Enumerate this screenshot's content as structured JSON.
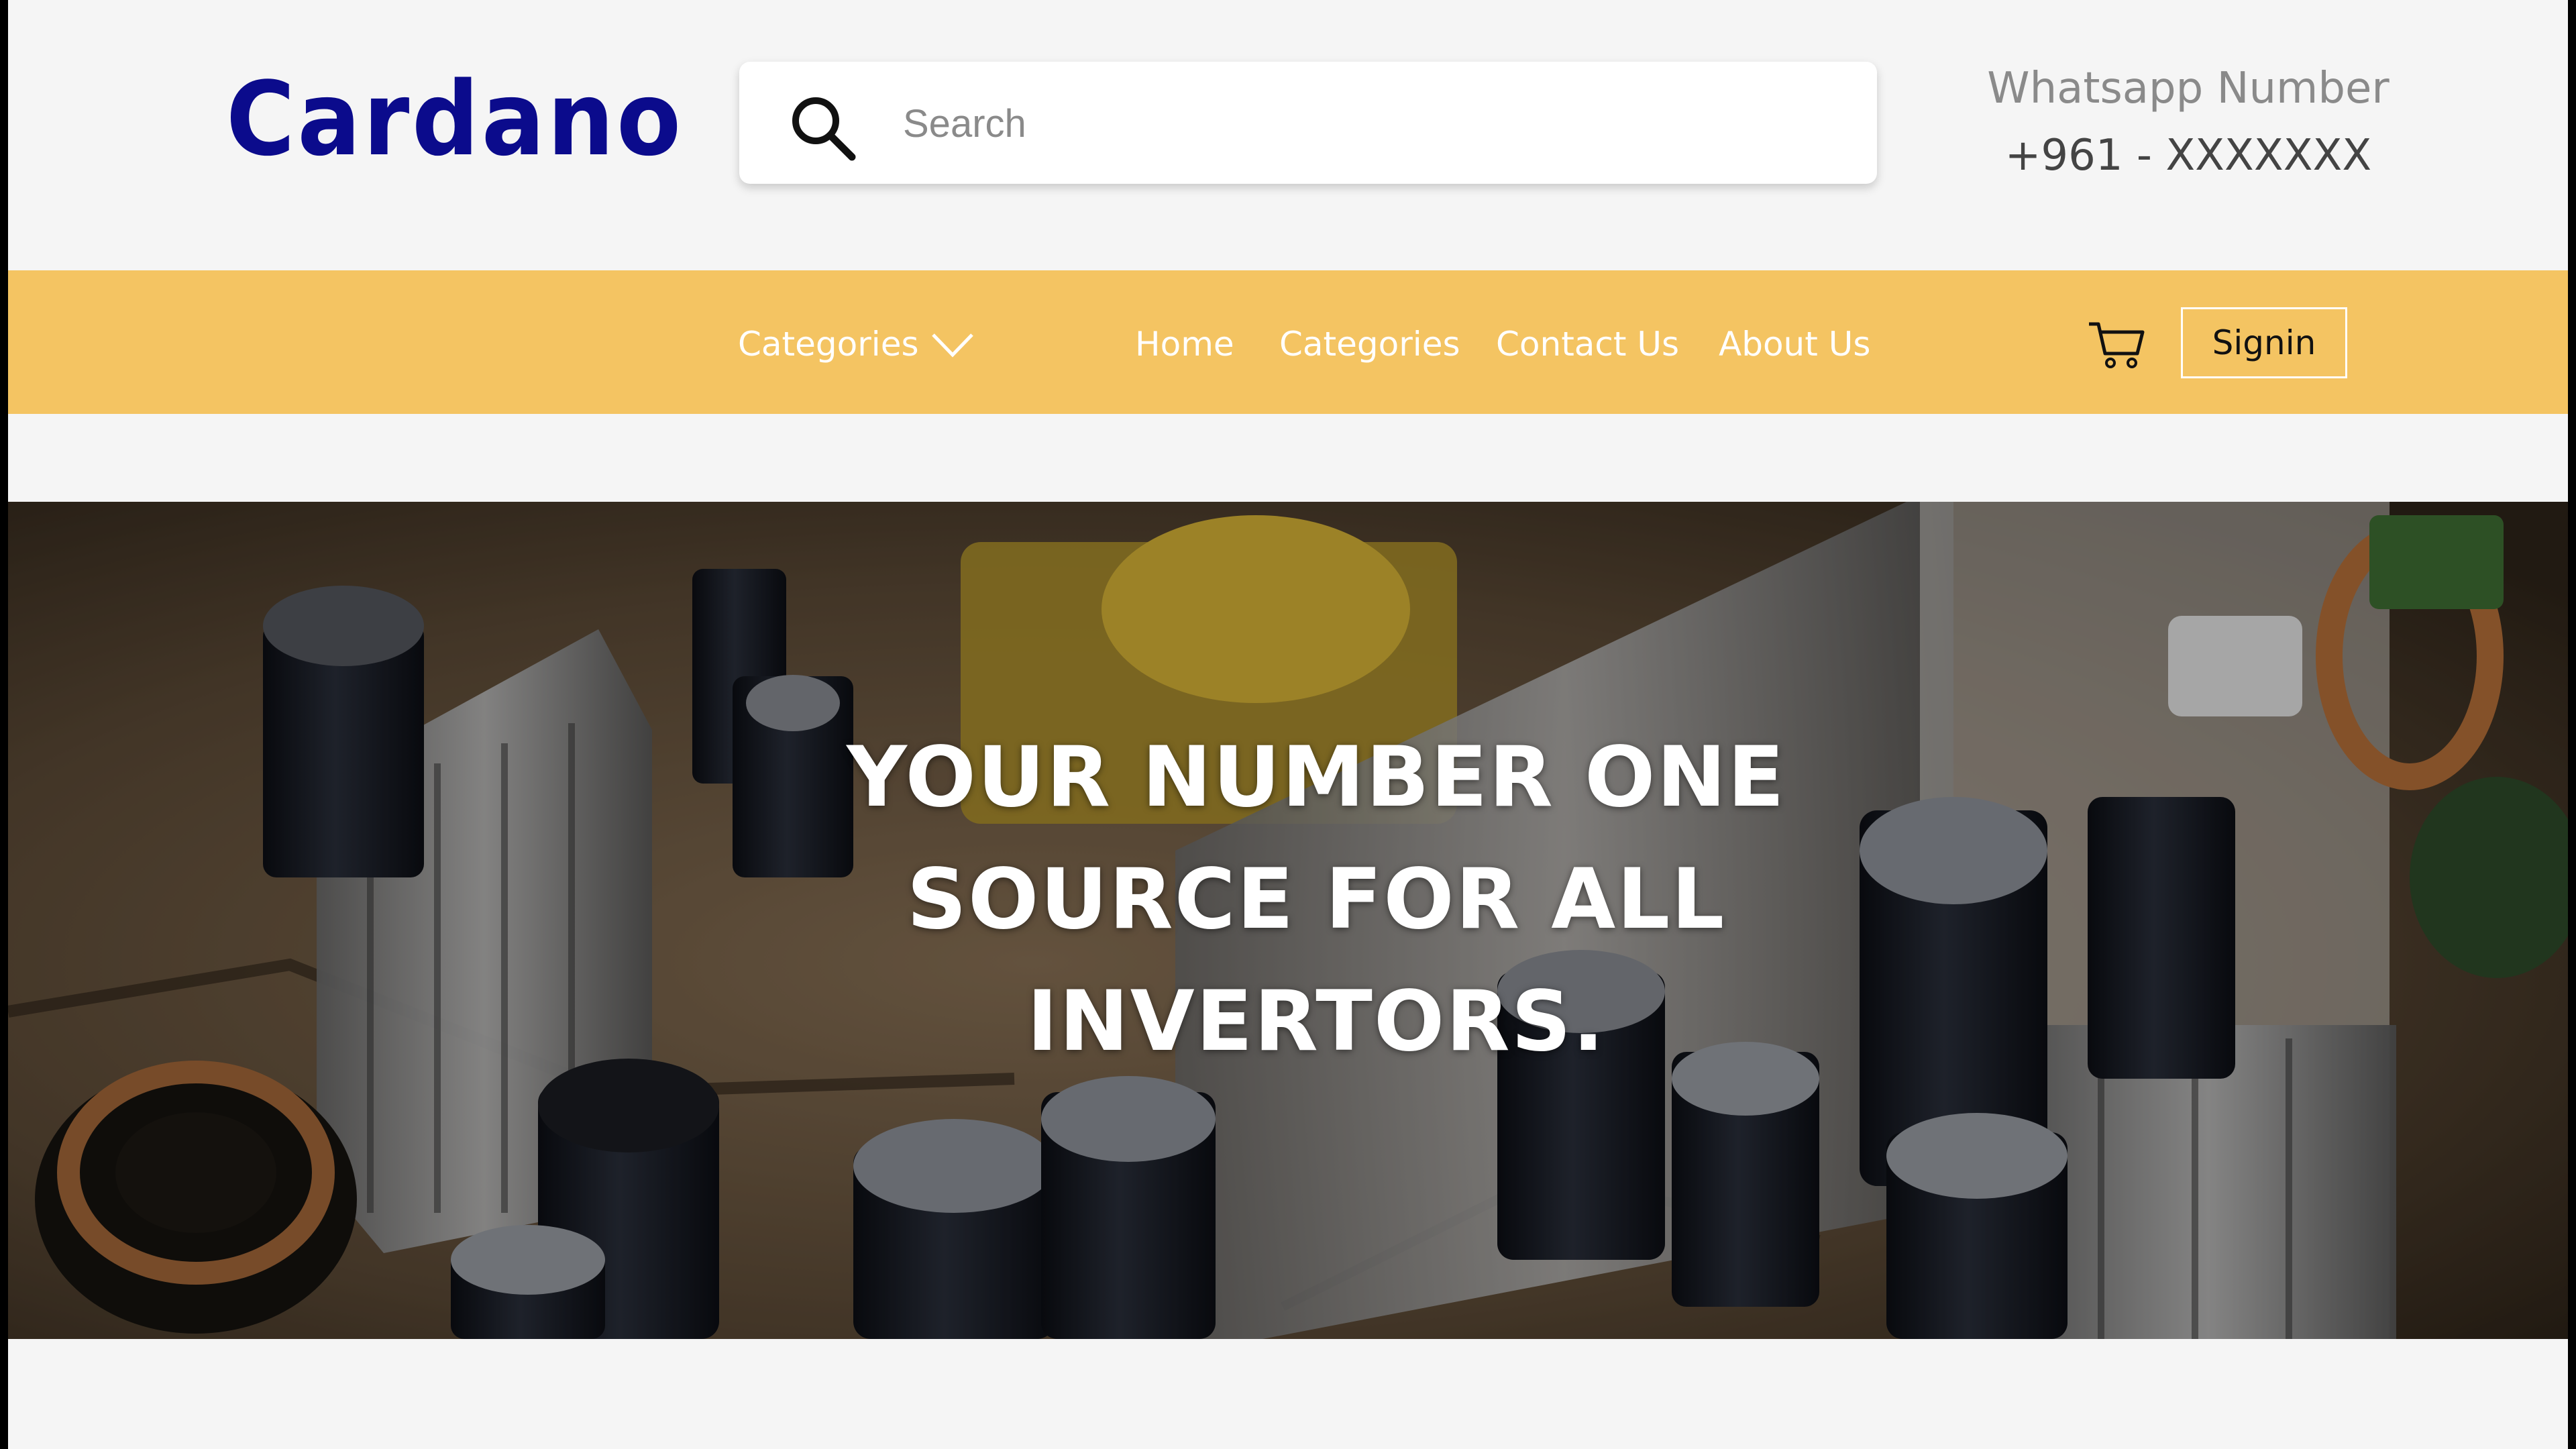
{
  "brand": {
    "name": "Cardano",
    "color": "#0b0b8c"
  },
  "search": {
    "placeholder": "Search",
    "icon": "search-icon"
  },
  "contact": {
    "label": "Whatsapp Number",
    "number": "+961 - XXXXXXX"
  },
  "nav": {
    "background": "#f4c462",
    "dropdown_label": "Categories",
    "links": [
      "Home",
      "Categories",
      "Contact Us",
      "About Us"
    ],
    "cart_icon": "cart-icon",
    "signin_label": "Signin"
  },
  "hero": {
    "title_lines": [
      "YOUR NUMBER ONE",
      "SOURCE FOR ALL",
      "INVERTORS."
    ],
    "image": "circuit board with capacitors and heat sinks"
  }
}
